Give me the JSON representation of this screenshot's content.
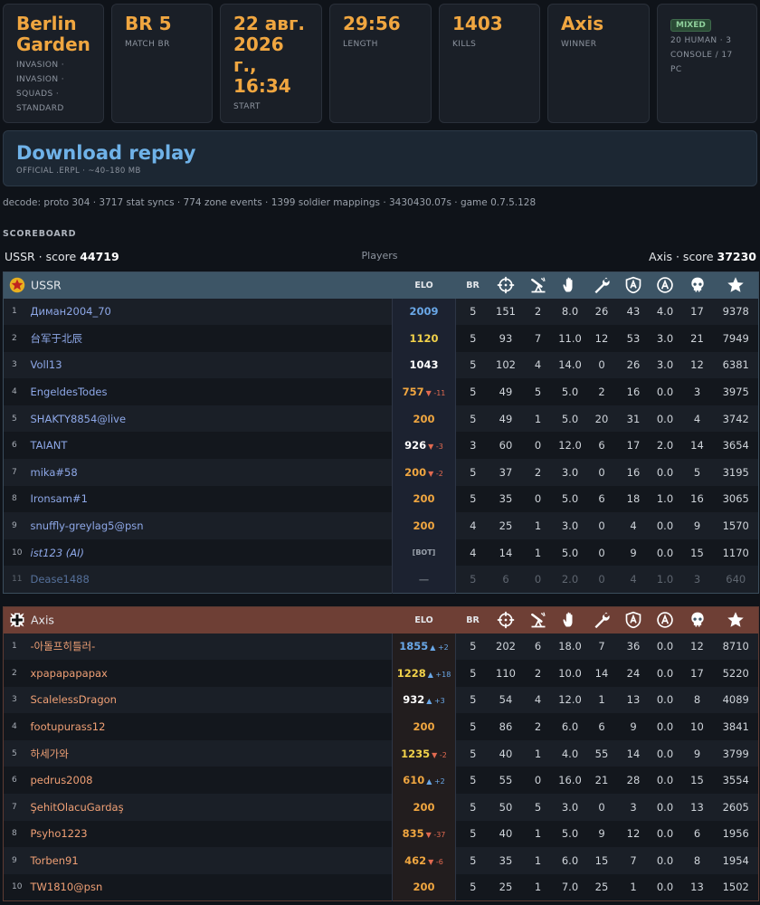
{
  "cards": [
    {
      "big": "Berlin Garden",
      "sub": "INVASION · INVASION · SQUADS · STANDARD"
    },
    {
      "big": "BR 5",
      "sub": "MATCH BR"
    },
    {
      "big": "22 авг. 2026 г., 16:34",
      "sub": "START"
    },
    {
      "big": "29:56",
      "sub": "LENGTH"
    },
    {
      "big": "1403",
      "sub": "KILLS"
    },
    {
      "big": "Axis",
      "sub": "WINNER"
    },
    {
      "badge": "MIXED",
      "sub": "20 HUMAN · 3 CONSOLE / 17 PC"
    }
  ],
  "download": {
    "title": "Download replay",
    "meta": "OFFICIAL .ERPL · ~40–180 MB"
  },
  "decode": "decode: proto 304 · 3717 stat syncs · 774 zone events · 1399 soldier mappings · 3430430.07s · game 0.7.5.128",
  "scoreboard_label": "SCOREBOARD",
  "score": {
    "left_prefix": "USSR · score ",
    "left_value": "44719",
    "center": "Players",
    "right_prefix": "Axis · score ",
    "right_value": "37230"
  },
  "columns": {
    "elo": "ELO",
    "br": "BR"
  },
  "column_icons": [
    "crosshair-icon",
    "mortar-icon",
    "hand-icon",
    "wrench-icon",
    "shield-a-icon",
    "circle-a-icon",
    "skull-icon",
    "star-icon"
  ],
  "colors": {
    "accent": "#f0a640",
    "ussr_header": "#3d5566",
    "axis_header": "#6e3f35",
    "link": "#6fb2e8",
    "elo_up": "#6aa8e8",
    "elo_down": "#e26a50"
  },
  "ussr": {
    "name": "USSR",
    "players": [
      {
        "rank": "1",
        "name": "Диман2004_70",
        "elo": "2009",
        "elo_color": "#6aa8e8",
        "delta": "",
        "br": "5",
        "stats": [
          "151",
          "2",
          "8.0",
          "26",
          "43",
          "4.0",
          "17",
          "9378"
        ]
      },
      {
        "rank": "2",
        "name": "台军于北辰",
        "elo": "1120",
        "elo_color": "#f2d24a",
        "delta": "",
        "br": "5",
        "stats": [
          "93",
          "7",
          "11.0",
          "12",
          "53",
          "3.0",
          "21",
          "7949"
        ]
      },
      {
        "rank": "3",
        "name": "Voll13",
        "elo": "1043",
        "elo_color": "#ffffff",
        "delta": "",
        "br": "5",
        "stats": [
          "102",
          "4",
          "14.0",
          "0",
          "26",
          "3.0",
          "12",
          "6381"
        ]
      },
      {
        "rank": "4",
        "name": "EngeldesTodes",
        "elo": "757",
        "elo_color": "#f0a640",
        "delta": "▼ -11",
        "delta_dir": "dn",
        "br": "5",
        "stats": [
          "49",
          "5",
          "5.0",
          "2",
          "16",
          "0.0",
          "3",
          "3975"
        ]
      },
      {
        "rank": "5",
        "name": "SHAKTY8854@live",
        "elo": "200",
        "elo_color": "#f0a640",
        "delta": "",
        "br": "5",
        "stats": [
          "49",
          "1",
          "5.0",
          "20",
          "31",
          "0.0",
          "4",
          "3742"
        ]
      },
      {
        "rank": "6",
        "name": "TAIANT",
        "elo": "926",
        "elo_color": "#ffffff",
        "delta": "▼ -3",
        "delta_dir": "dn",
        "br": "3",
        "stats": [
          "60",
          "0",
          "12.0",
          "6",
          "17",
          "2.0",
          "14",
          "3654"
        ]
      },
      {
        "rank": "7",
        "name": "mika#58",
        "elo": "200",
        "elo_color": "#f0a640",
        "delta": "▼ -2",
        "delta_dir": "dn",
        "br": "5",
        "stats": [
          "37",
          "2",
          "3.0",
          "0",
          "16",
          "0.0",
          "5",
          "3195"
        ]
      },
      {
        "rank": "8",
        "name": "Ironsam#1",
        "elo": "200",
        "elo_color": "#f0a640",
        "delta": "",
        "br": "5",
        "stats": [
          "35",
          "0",
          "5.0",
          "6",
          "18",
          "1.0",
          "16",
          "3065"
        ]
      },
      {
        "rank": "9",
        "name": "snuffly-greylag5@psn",
        "elo": "200",
        "elo_color": "#f0a640",
        "delta": "",
        "br": "4",
        "stats": [
          "25",
          "1",
          "3.0",
          "0",
          "4",
          "0.0",
          "9",
          "1570"
        ]
      },
      {
        "rank": "10",
        "name": "ist123 (AI)",
        "elo": "[BOT]",
        "elo_color": "#9aa1ab",
        "delta": "",
        "br": "4",
        "stats": [
          "14",
          "1",
          "5.0",
          "0",
          "9",
          "0.0",
          "15",
          "1170"
        ],
        "ai": true
      },
      {
        "rank": "11",
        "name": "Dease1488",
        "elo": "—",
        "elo_color": "#5f6670",
        "delta": "",
        "br": "5",
        "stats": [
          "6",
          "0",
          "2.0",
          "0",
          "4",
          "1.0",
          "3",
          "640"
        ],
        "dim": true
      }
    ]
  },
  "axis": {
    "name": "Axis",
    "players": [
      {
        "rank": "1",
        "name": "-아돌프히틀러-",
        "elo": "1855",
        "elo_color": "#6aa8e8",
        "delta": "▲ +2",
        "delta_dir": "up",
        "br": "5",
        "stats": [
          "202",
          "6",
          "18.0",
          "7",
          "36",
          "0.0",
          "12",
          "8710"
        ]
      },
      {
        "rank": "2",
        "name": "xpapapapapax",
        "elo": "1228",
        "elo_color": "#f2d24a",
        "delta": "▲ +18",
        "delta_dir": "up",
        "br": "5",
        "stats": [
          "110",
          "2",
          "10.0",
          "14",
          "24",
          "0.0",
          "17",
          "5220"
        ]
      },
      {
        "rank": "3",
        "name": "ScalelessDragon",
        "elo": "932",
        "elo_color": "#ffffff",
        "delta": "▲ +3",
        "delta_dir": "up",
        "br": "5",
        "stats": [
          "54",
          "4",
          "12.0",
          "1",
          "13",
          "0.0",
          "8",
          "4089"
        ]
      },
      {
        "rank": "4",
        "name": "footupurass12",
        "elo": "200",
        "elo_color": "#f0a640",
        "delta": "",
        "br": "5",
        "stats": [
          "86",
          "2",
          "6.0",
          "6",
          "9",
          "0.0",
          "10",
          "3841"
        ]
      },
      {
        "rank": "5",
        "name": "하세가와",
        "elo": "1235",
        "elo_color": "#f2d24a",
        "delta": "▼ -2",
        "delta_dir": "dn",
        "br": "5",
        "stats": [
          "40",
          "1",
          "4.0",
          "55",
          "14",
          "0.0",
          "9",
          "3799"
        ]
      },
      {
        "rank": "6",
        "name": "pedrus2008",
        "elo": "610",
        "elo_color": "#f0a640",
        "delta": "▲ +2",
        "delta_dir": "up",
        "br": "5",
        "stats": [
          "55",
          "0",
          "16.0",
          "21",
          "28",
          "0.0",
          "15",
          "3554"
        ]
      },
      {
        "rank": "7",
        "name": "ŞehitOlacuGardaş",
        "elo": "200",
        "elo_color": "#f0a640",
        "delta": "",
        "br": "5",
        "stats": [
          "50",
          "5",
          "3.0",
          "0",
          "3",
          "0.0",
          "13",
          "2605"
        ]
      },
      {
        "rank": "8",
        "name": "Psyho1223",
        "elo": "835",
        "elo_color": "#f0a640",
        "delta": "▼ -37",
        "delta_dir": "dn",
        "br": "5",
        "stats": [
          "40",
          "1",
          "5.0",
          "9",
          "12",
          "0.0",
          "6",
          "1956"
        ]
      },
      {
        "rank": "9",
        "name": "Torben91",
        "elo": "462",
        "elo_color": "#f0a640",
        "delta": "▼ -6",
        "delta_dir": "dn",
        "br": "5",
        "stats": [
          "35",
          "1",
          "6.0",
          "15",
          "7",
          "0.0",
          "8",
          "1954"
        ]
      },
      {
        "rank": "10",
        "name": "TW1810@psn",
        "elo": "200",
        "elo_color": "#f0a640",
        "delta": "",
        "br": "5",
        "stats": [
          "25",
          "1",
          "7.0",
          "25",
          "1",
          "0.0",
          "13",
          "1502"
        ]
      }
    ]
  }
}
